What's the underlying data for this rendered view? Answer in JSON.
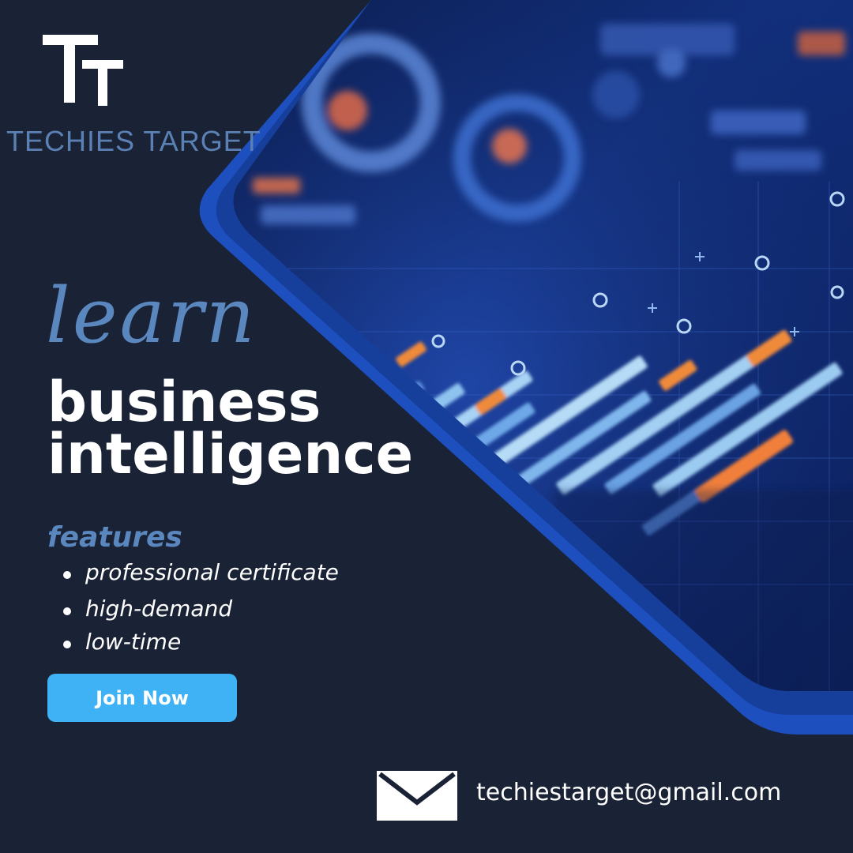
{
  "brand": {
    "logo_letters": "TT",
    "name": "TECHIES TARGET"
  },
  "headline": {
    "script_word": "learn",
    "line1": "business",
    "line2": "intelligence"
  },
  "features": {
    "title": "features",
    "items": [
      "professional certificate",
      "high-demand",
      "low-time"
    ]
  },
  "cta": {
    "label": "Join Now"
  },
  "contact": {
    "email": "techiestarget@gmail.com"
  },
  "colors": {
    "background": "#1a2235",
    "accent_blue": "#5b87bf",
    "button_blue": "#3fb1f5",
    "panel_border": "#1f57c6"
  },
  "icons": {
    "logo": "tt-logo-icon",
    "mail": "envelope-icon"
  }
}
